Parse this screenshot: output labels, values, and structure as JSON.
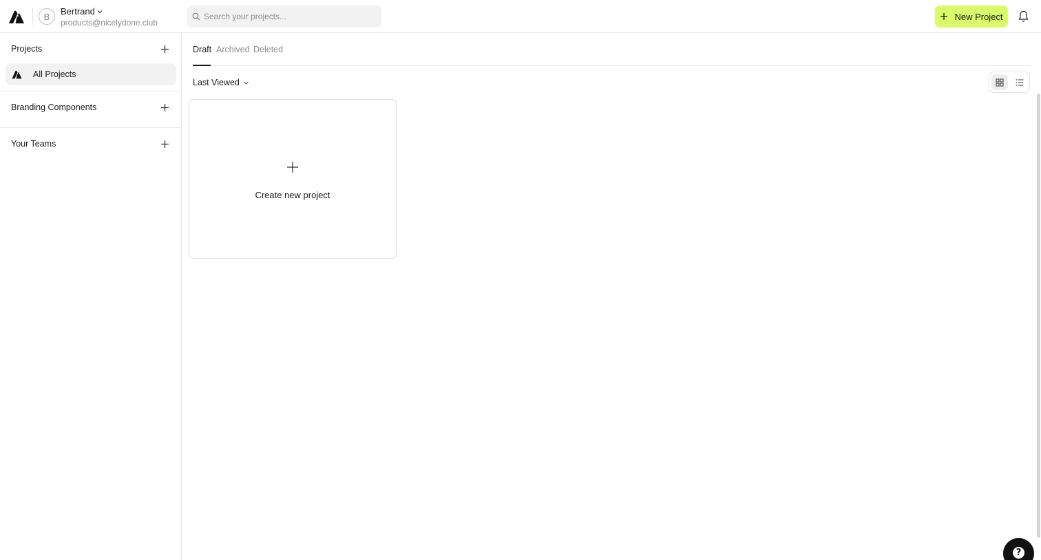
{
  "header": {
    "logo_icon": "brand-logo-icon",
    "user": {
      "avatar_initial": "B",
      "name": "Bertrand",
      "email": "products@nicelydone.club"
    },
    "search": {
      "placeholder": "Search your projects...",
      "value": ""
    },
    "new_project_label": "New Project",
    "accent_color": "#d9fb6a",
    "notifications_icon": "bell-icon"
  },
  "sidebar": {
    "projects_title": "Projects",
    "all_projects_label": "All Projects",
    "branding_title": "Branding Components",
    "teams_title": "Your Teams"
  },
  "main": {
    "tabs": [
      {
        "label": "Draft",
        "active": true
      },
      {
        "label": "Archived",
        "active": false
      },
      {
        "label": "Deleted",
        "active": false
      }
    ],
    "sort_label": "Last Viewed",
    "view_mode": "grid",
    "create_card_label": "Create new project"
  },
  "help_label": "?"
}
